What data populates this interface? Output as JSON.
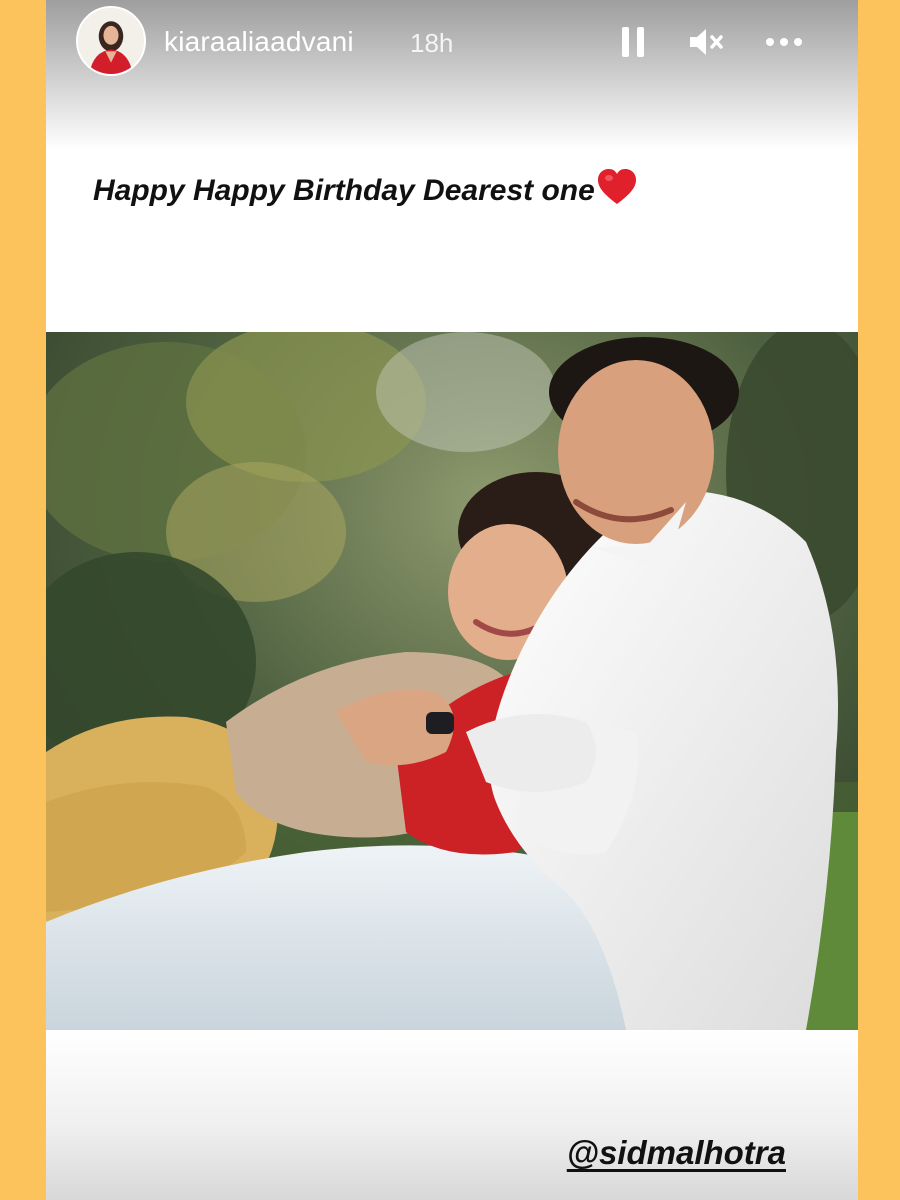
{
  "story": {
    "username": "kiaraaliaadvani",
    "time_ago": "18h",
    "caption": "Happy Happy Birthday Dearest one",
    "caption_emoji": "red-heart",
    "mention": "@sidmalhotra"
  },
  "controls": {
    "pause_icon": "pause-icon",
    "mute_icon": "speaker-muted-icon",
    "more_icon": "more-dots-icon"
  },
  "colors": {
    "frame": "#fcc25c",
    "story_bg": "#ffffff",
    "heart": "#e0202a",
    "text": "#111111"
  }
}
